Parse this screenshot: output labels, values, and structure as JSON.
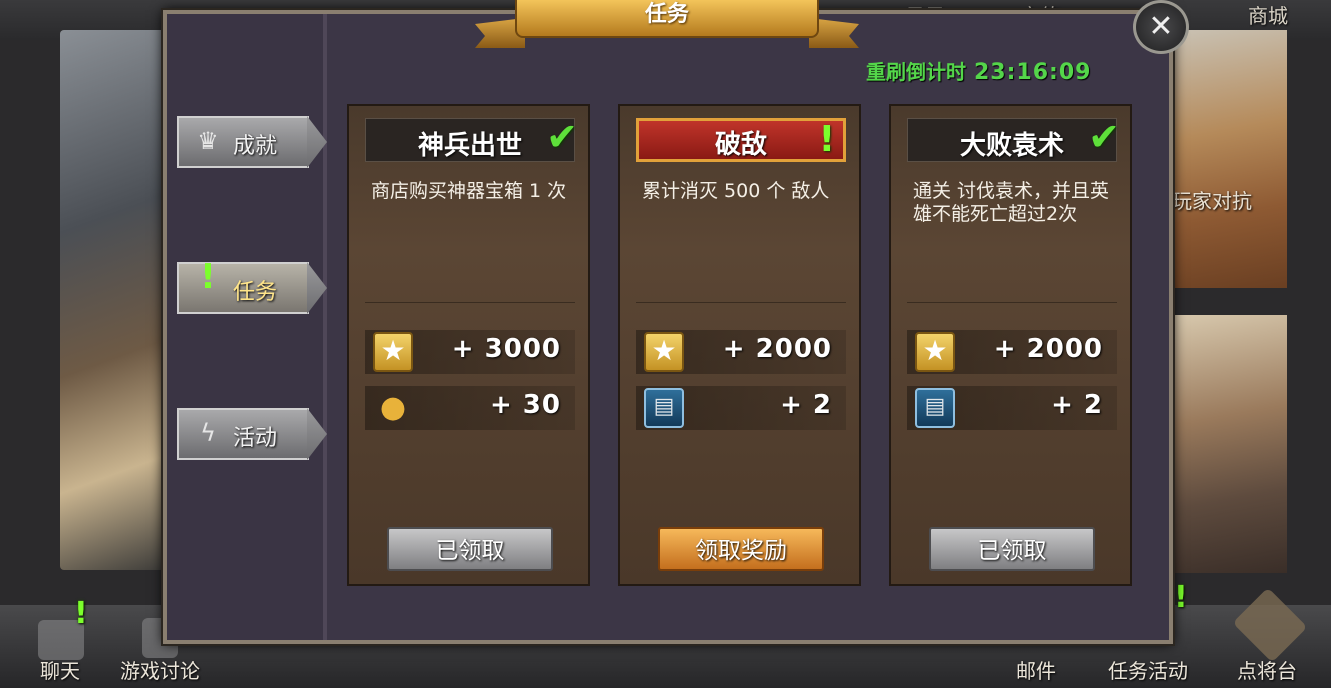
{
  "background": {
    "top_nav": [
      "日子",
      "充值",
      "商城"
    ],
    "right_panel_label": "玩家对抗",
    "bottom_nav": [
      "聊天",
      "游戏讨论",
      "邮件",
      "任务活动",
      "点将台"
    ]
  },
  "dialog": {
    "title": "任务",
    "refresh_label": "重刷倒计时",
    "refresh_timer": "23:16:09",
    "close_icon": "close-icon"
  },
  "tabs": [
    {
      "label": "成就",
      "icon": "crown-icon",
      "active": false
    },
    {
      "label": "任务",
      "icon": "exclamation-icon",
      "active": true
    },
    {
      "label": "活动",
      "icon": "lightning-icon",
      "active": false
    }
  ],
  "quests": [
    {
      "title": "神兵出世",
      "status": "completed",
      "description": "商店购买神器宝箱 1 次",
      "reward1": "+ 3000",
      "reward2": "+ 30",
      "reward2_icon": "gold-coins-icon",
      "button": "已领取"
    },
    {
      "title": "破敌",
      "status": "claimable",
      "description": "累计消灭 500 个 敌人",
      "reward1": "+ 2000",
      "reward2": "+ 2",
      "reward2_icon": "card-pack-icon",
      "button": "领取奖励"
    },
    {
      "title": "大败袁术",
      "status": "completed",
      "description": "通关 讨伐袁术，并且英雄不能死亡超过2次",
      "reward1": "+ 2000",
      "reward2": "+ 2",
      "reward2_icon": "card-pack-icon",
      "button": "已领取"
    }
  ],
  "colors": {
    "timer_green": "#54d64a",
    "check_green": "#5ee03a",
    "title_gold": "#f3c45a",
    "claim_orange": "#e4922e"
  }
}
